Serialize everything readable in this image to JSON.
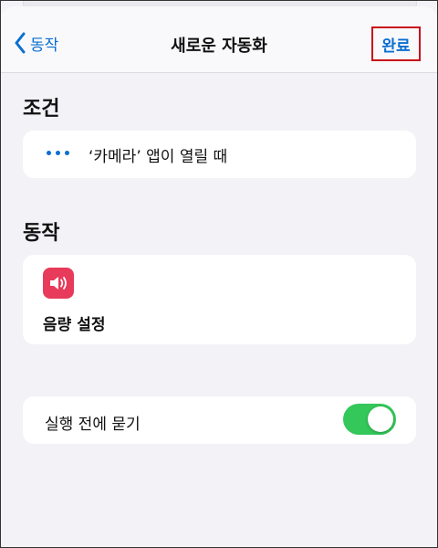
{
  "nav": {
    "back_label": "동작",
    "title": "새로운 자동화",
    "done_label": "완료"
  },
  "condition": {
    "heading": "조건",
    "text": "‘카메라’ 앱이 열릴 때"
  },
  "action": {
    "heading": "동작",
    "item_label": "음량 설정",
    "icon": "speaker-volume-icon"
  },
  "ask": {
    "label": "실행 전에 묻기",
    "enabled": true
  },
  "colors": {
    "accent": "#0a6fd0",
    "toggle_on": "#34c759",
    "volume_icon_bg": "#e83a5a",
    "highlight_border": "#c8101a"
  }
}
